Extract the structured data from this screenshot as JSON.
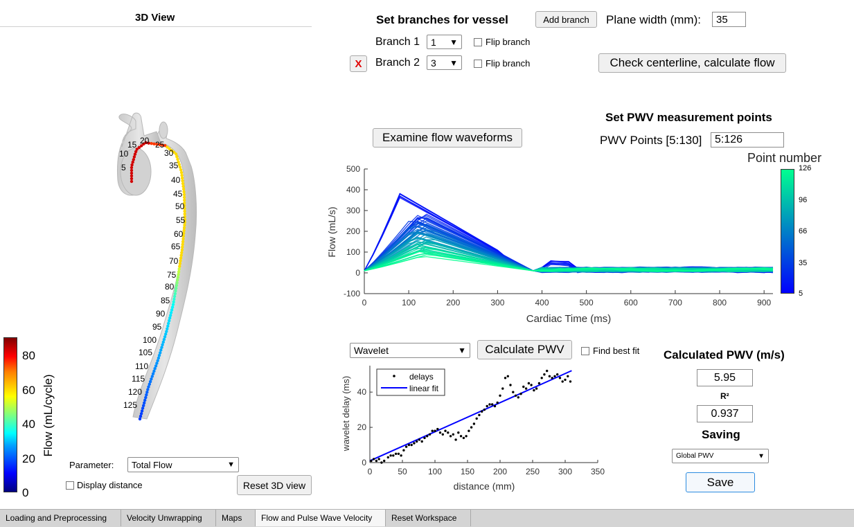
{
  "view3d": {
    "title": "3D View",
    "centerline_labels": [
      "5",
      "10",
      "15",
      "20",
      "25",
      "30",
      "35",
      "40",
      "45",
      "50",
      "55",
      "60",
      "65",
      "70",
      "75",
      "80",
      "85",
      "90",
      "95",
      "100",
      "105",
      "110",
      "115",
      "120",
      "125"
    ],
    "colorbar_label": "Flow (mL/cycle)",
    "colorbar_ticks": [
      "80",
      "60",
      "40",
      "20",
      "0"
    ],
    "parameter_label": "Parameter:",
    "parameter_value": "Total Flow",
    "display_distance_label": "Display distance",
    "reset_label": "Reset 3D view"
  },
  "branches": {
    "title": "Set branches for vessel",
    "add_branch_label": "Add branch",
    "plane_width_label": "Plane width (mm):",
    "plane_width_value": "35",
    "rows": [
      {
        "label": "Branch 1",
        "value": "1",
        "flip_label": "Flip branch"
      },
      {
        "label": "Branch 2",
        "value": "3",
        "flip_label": "Flip branch",
        "remove_label": "X"
      }
    ],
    "check_label": "Check centerline, calculate flow"
  },
  "pwv_points": {
    "title": "Set PWV measurement points",
    "label": "PWV Points [5:130]",
    "value": "5:126"
  },
  "examine_label": "Examine flow waveforms",
  "waveform_chart": {
    "ylabel": "Flow (mL/s)",
    "xlabel": "Cardiac Time (ms)",
    "yticks": [
      "500",
      "400",
      "300",
      "200",
      "100",
      "0",
      "-100"
    ],
    "xticks": [
      "0",
      "100",
      "200",
      "300",
      "400",
      "500",
      "600",
      "700",
      "800",
      "900"
    ],
    "colorbar_title": "Point number",
    "colorbar_ticks": [
      "126",
      "96",
      "66",
      "35",
      "5"
    ],
    "colors": {
      "low": "#0000ff",
      "high": "#00ff90"
    }
  },
  "pwv_calc": {
    "method_value": "Wavelet",
    "calculate_label": "Calculate PWV",
    "find_best_fit_label": "Find best fit"
  },
  "chart_data": {
    "type": "scatter",
    "xlabel": "distance (mm)",
    "ylabel": "wavelet delay (ms)",
    "xlim": [
      0,
      350
    ],
    "ylim": [
      0,
      55
    ],
    "xticks": [
      "0",
      "50",
      "100",
      "150",
      "200",
      "250",
      "300",
      "350"
    ],
    "yticks": [
      "0",
      "20",
      "40"
    ],
    "legend": [
      "delays",
      "linear fit"
    ],
    "legend_position": "top-left",
    "series": [
      {
        "name": "delays",
        "points": [
          [
            2,
            1
          ],
          [
            6,
            2
          ],
          [
            10,
            1
          ],
          [
            14,
            2
          ],
          [
            18,
            0
          ],
          [
            22,
            1
          ],
          [
            28,
            3
          ],
          [
            32,
            4
          ],
          [
            36,
            4
          ],
          [
            40,
            5
          ],
          [
            44,
            5
          ],
          [
            48,
            4
          ],
          [
            52,
            7
          ],
          [
            56,
            9
          ],
          [
            60,
            10
          ],
          [
            64,
            10
          ],
          [
            68,
            11
          ],
          [
            72,
            12
          ],
          [
            76,
            13
          ],
          [
            80,
            12
          ],
          [
            84,
            14
          ],
          [
            88,
            15
          ],
          [
            92,
            16
          ],
          [
            96,
            18
          ],
          [
            100,
            18
          ],
          [
            104,
            19
          ],
          [
            108,
            17
          ],
          [
            112,
            16
          ],
          [
            116,
            18
          ],
          [
            120,
            17
          ],
          [
            124,
            15
          ],
          [
            128,
            16
          ],
          [
            132,
            13
          ],
          [
            136,
            17
          ],
          [
            140,
            15
          ],
          [
            144,
            14
          ],
          [
            148,
            15
          ],
          [
            152,
            18
          ],
          [
            156,
            20
          ],
          [
            160,
            22
          ],
          [
            164,
            25
          ],
          [
            168,
            27
          ],
          [
            172,
            29
          ],
          [
            176,
            30
          ],
          [
            180,
            32
          ],
          [
            184,
            33
          ],
          [
            188,
            33
          ],
          [
            192,
            32
          ],
          [
            196,
            34
          ],
          [
            200,
            38
          ],
          [
            204,
            42
          ],
          [
            208,
            48
          ],
          [
            212,
            49
          ],
          [
            216,
            44
          ],
          [
            220,
            40
          ],
          [
            224,
            38
          ],
          [
            228,
            37
          ],
          [
            232,
            39
          ],
          [
            236,
            43
          ],
          [
            240,
            42
          ],
          [
            244,
            45
          ],
          [
            248,
            44
          ],
          [
            252,
            41
          ],
          [
            256,
            42
          ],
          [
            260,
            45
          ],
          [
            264,
            48
          ],
          [
            268,
            50
          ],
          [
            272,
            52
          ],
          [
            276,
            49
          ],
          [
            280,
            48
          ],
          [
            284,
            49
          ],
          [
            288,
            50
          ],
          [
            292,
            48
          ],
          [
            296,
            46
          ],
          [
            300,
            47
          ],
          [
            304,
            49
          ],
          [
            308,
            46
          ]
        ]
      },
      {
        "name": "linear fit",
        "slope": 0.165,
        "intercept": 1.0
      }
    ]
  },
  "results": {
    "title": "Calculated PWV (m/s)",
    "pwv_value": "5.95",
    "r2_label": "R²",
    "r2_value": "0.937",
    "saving_title": "Saving",
    "saving_value": "Global PWV",
    "save_label": "Save"
  },
  "tabs": [
    "Loading and Preprocessing",
    "Velocity Unwrapping",
    "Maps",
    "Flow and Pulse Wave Velocity",
    "Reset Workspace"
  ],
  "active_tab": 3
}
